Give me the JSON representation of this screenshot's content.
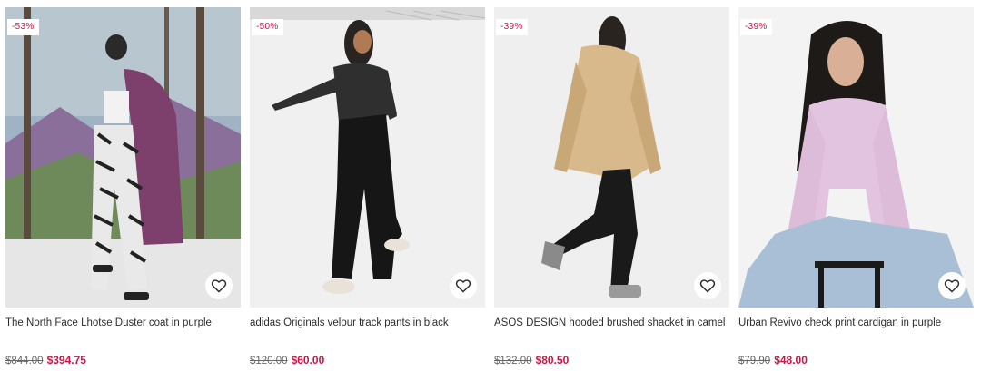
{
  "products": [
    {
      "badge": "-53%",
      "title": "The North Face Lhotse Duster coat in purple",
      "was_price": "$844.00",
      "now_price": "$394.75",
      "wishlist_icon": "heart-icon"
    },
    {
      "badge": "-50%",
      "title": "adidas Originals velour track pants in black",
      "was_price": "$120.00",
      "now_price": "$60.00",
      "wishlist_icon": "heart-icon"
    },
    {
      "badge": "-39%",
      "title": "ASOS DESIGN hooded brushed shacket in camel",
      "was_price": "$132.00",
      "now_price": "$80.50",
      "wishlist_icon": "heart-icon"
    },
    {
      "badge": "-39%",
      "title": "Urban Revivo check print cardigan in purple",
      "was_price": "$79.90",
      "now_price": "$48.00",
      "wishlist_icon": "heart-icon"
    }
  ],
  "colors": {
    "sale_red": "#d01345",
    "text": "#2d2d2d",
    "strike": "#666666"
  }
}
